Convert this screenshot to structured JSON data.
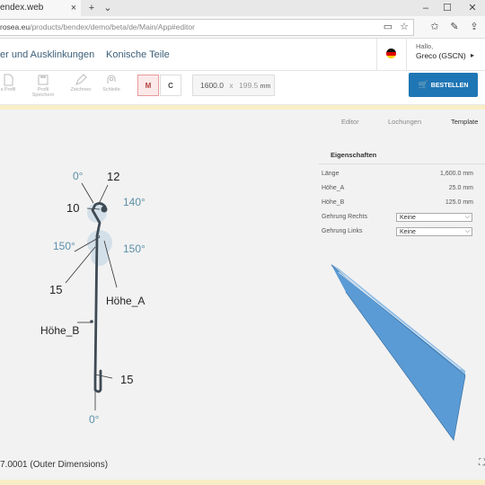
{
  "browser": {
    "tab_title": "endex.web",
    "new_tab": "+",
    "tab_menu": "⌄",
    "url_host": "rosea.eu",
    "url_path": "/products/bendex/demo/beta/de/Main/App#editor",
    "minimize": "–",
    "maximize": "☐"
  },
  "header": {
    "nav": [
      "er und Ausklinkungen",
      "Konische Teile"
    ],
    "greeting": "Hallo,",
    "user": "Greco (GSCN)",
    "user_chevron": "▸"
  },
  "toolbar": {
    "tools": [
      "s Profil",
      "Profil Speichern",
      "Zeichnen",
      "Schleife"
    ],
    "mode_m": "M",
    "mode_c": "C",
    "length": "1600.0",
    "times": "x",
    "width": "199.5",
    "unit": "mm",
    "order_button": "BESTELLEN"
  },
  "view_tabs": [
    "Editor",
    "Lochungen",
    "Template"
  ],
  "drawing": {
    "labels": [
      "0°",
      "12",
      "10",
      "140°",
      "150°",
      "150°",
      "15",
      "Höhe_A",
      "Höhe_B",
      "15",
      "0°"
    ],
    "accent_color": "#5b8fa8",
    "profile_color": "#3e4a54"
  },
  "properties": {
    "title": "Eigenschaften",
    "rows": [
      {
        "label": "Länge",
        "value": "1,600.0 mm"
      },
      {
        "label": "Höhe_A",
        "value": "25.0 mm"
      },
      {
        "label": "Höhe_B",
        "value": "125.0 mm"
      },
      {
        "label": "Gehrung Rechts",
        "value": "Keine"
      },
      {
        "label": "Gehrung Links",
        "value": "Keine"
      }
    ]
  },
  "footer": {
    "text": "7.0001 (Outer Dimensions)"
  },
  "colors": {
    "brand": "#1f76b4",
    "warning_strip": "#f8eec6",
    "model_blue": "#5b9bd5"
  }
}
